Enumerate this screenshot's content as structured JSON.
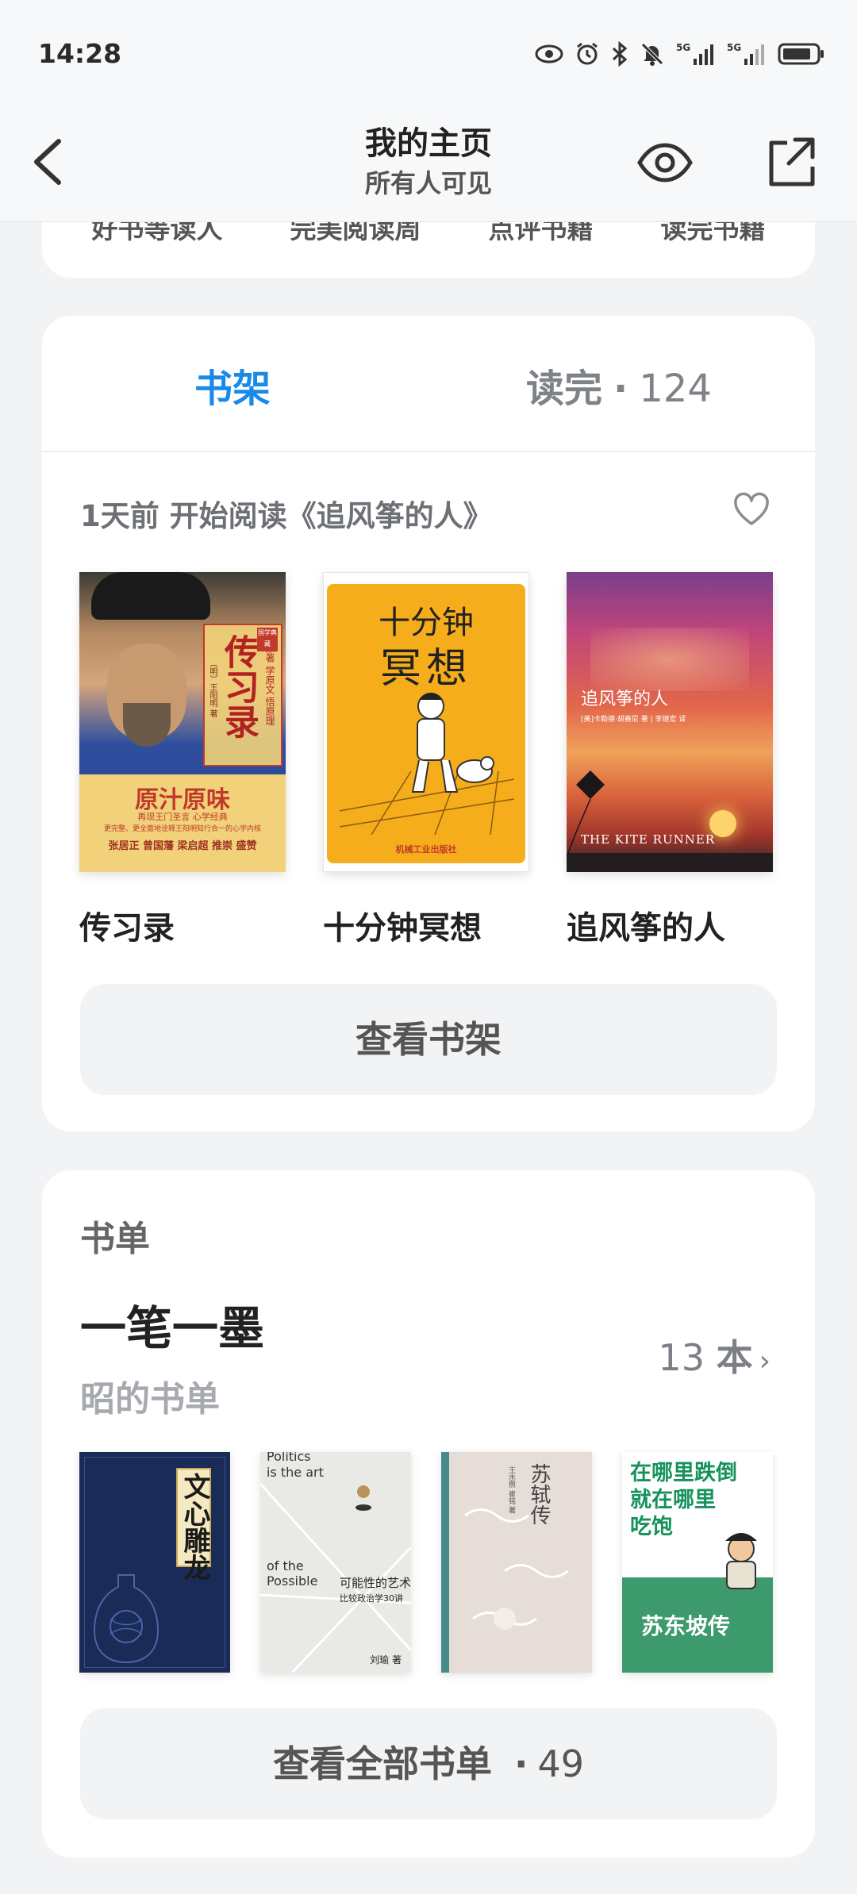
{
  "status": {
    "time": "14:28",
    "signal1": "5G",
    "signal2": "5G"
  },
  "nav": {
    "title": "我的主页",
    "subtitle": "所有人可见"
  },
  "stats": [
    "好书等读人",
    "完美阅读周",
    "点评书籍",
    "读完书籍"
  ],
  "tabs": {
    "shelf": "书架",
    "done": "读完",
    "done_dot": "·",
    "done_count": "124"
  },
  "recent": {
    "text": "1天前 开始阅读《追风筝的人》"
  },
  "books": [
    {
      "title": "传习录",
      "cover_text": "传习录",
      "cover_side": "读原著 学原文 悟原理",
      "cover_author": "〔明〕王阳明 著",
      "cover_slogan": "原汁原味",
      "cover_sub1": "再现王门圣言 心学经典",
      "cover_sub2": "更完整、更全面地诠释王阳明知行合一的心学内核",
      "cover_sub3": "张居正 曾国藩 梁启超 推崇 盛赞",
      "cover_badge": "国学典藏"
    },
    {
      "title": "十分钟冥想",
      "cover_line1": "十分钟",
      "cover_line2": "冥想",
      "cover_publisher": "机械工业出版社"
    },
    {
      "title": "追风筝的人",
      "cover_title": "追风筝的人",
      "cover_author": "[美]卡勒德·胡赛尼 著 | 李继宏 译",
      "cover_en": "THE KITE RUNNER"
    }
  ],
  "shelf_button": "查看书架",
  "booklist": {
    "label": "书单",
    "name": "一笔一墨",
    "owner": "昭的书单",
    "count": "13",
    "unit": "本",
    "chevron": "›",
    "covers": [
      {
        "title": "文心雕龙",
        "colors": [
          "#1a2b58",
          "#f4e9c0"
        ]
      },
      {
        "title": "可能性的艺术",
        "en1": "Politics",
        "en2": "is the art",
        "en3": "of the",
        "en4": "Possible",
        "sub": "比较政治学30讲",
        "author": "刘瑜 著"
      },
      {
        "title": "苏轼传",
        "author": "王水照 崔铭 著"
      },
      {
        "title1": "在哪里跌倒",
        "title2": "就在哪里",
        "title3": "吃饱",
        "name": "苏东坡传"
      }
    ],
    "button_text": "查看全部书单",
    "button_dot": "·",
    "button_count": "49"
  }
}
